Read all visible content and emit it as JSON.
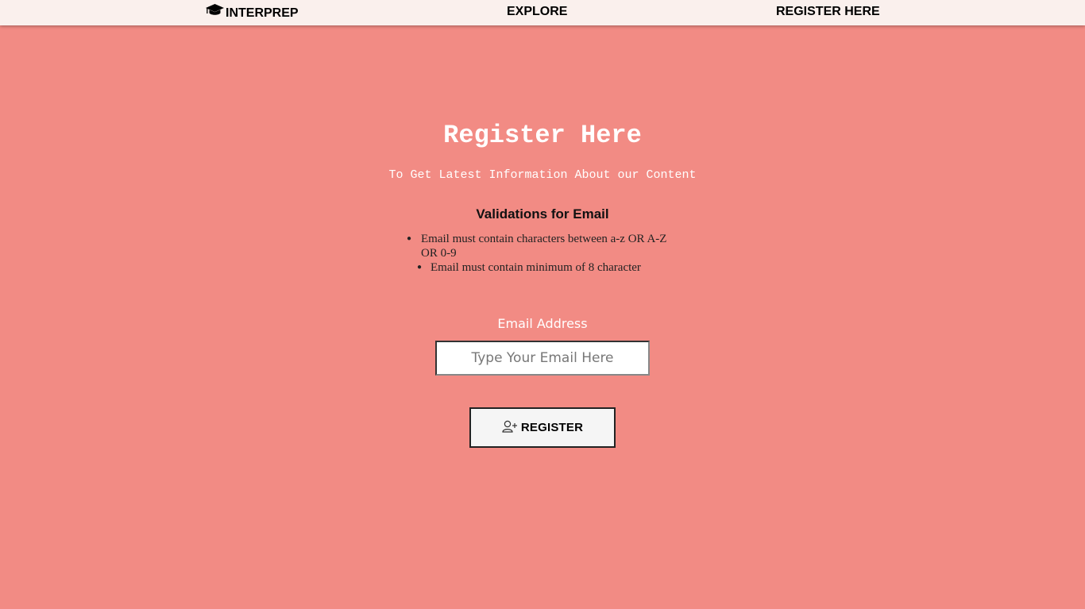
{
  "navbar": {
    "brand_label": "INTERPREP",
    "brand_icon": "graduation-cap-icon",
    "explore_label": "EXPLORE",
    "register_label": "REGISTER HERE"
  },
  "main": {
    "title": "Register Here",
    "subtitle": "To Get Latest Information About our Content",
    "validations_heading": "Validations for Email",
    "rules": [
      "Email must contain characters between a-z OR A-Z OR 0-9",
      "Email must contain minimum of 8 character"
    ]
  },
  "form": {
    "email_label": "Email Address",
    "email_value": "",
    "email_placeholder": "Type Your Email Here",
    "register_button_label": "REGISTER",
    "register_button_icon": "user-plus-icon"
  },
  "colors": {
    "page_background": "#f28b84",
    "navbar_background": "#faf0ed",
    "heading_text": "#ffffff"
  }
}
